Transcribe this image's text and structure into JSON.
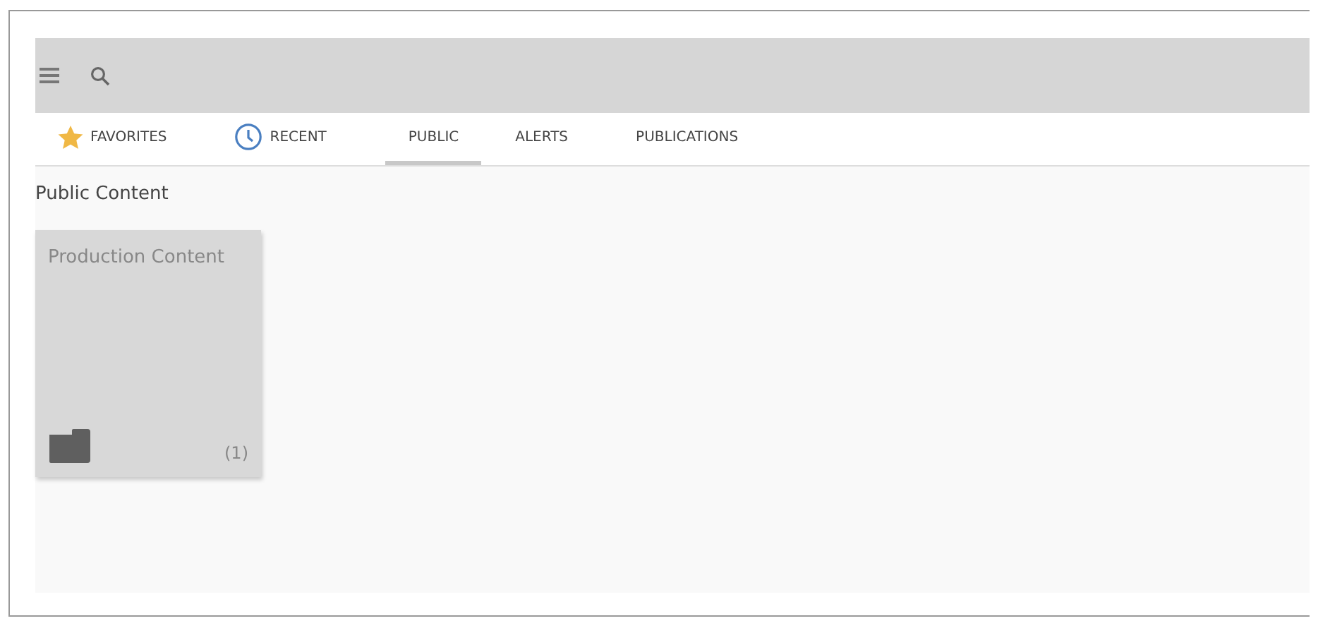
{
  "tabs": [
    {
      "label": "FAVORITES",
      "kind": "starred",
      "selected": false
    },
    {
      "label": "RECENT",
      "kind": "timed",
      "selected": false
    },
    {
      "label": "PUBLIC",
      "kind": "plain",
      "selected": true
    },
    {
      "label": "ALERTS",
      "kind": "plain",
      "selected": false
    },
    {
      "label": "PUBLICATIONS",
      "kind": "plain",
      "selected": false
    }
  ],
  "section_title": "Public Content",
  "cards": [
    {
      "title": "Production Content",
      "count": "(1)"
    }
  ]
}
